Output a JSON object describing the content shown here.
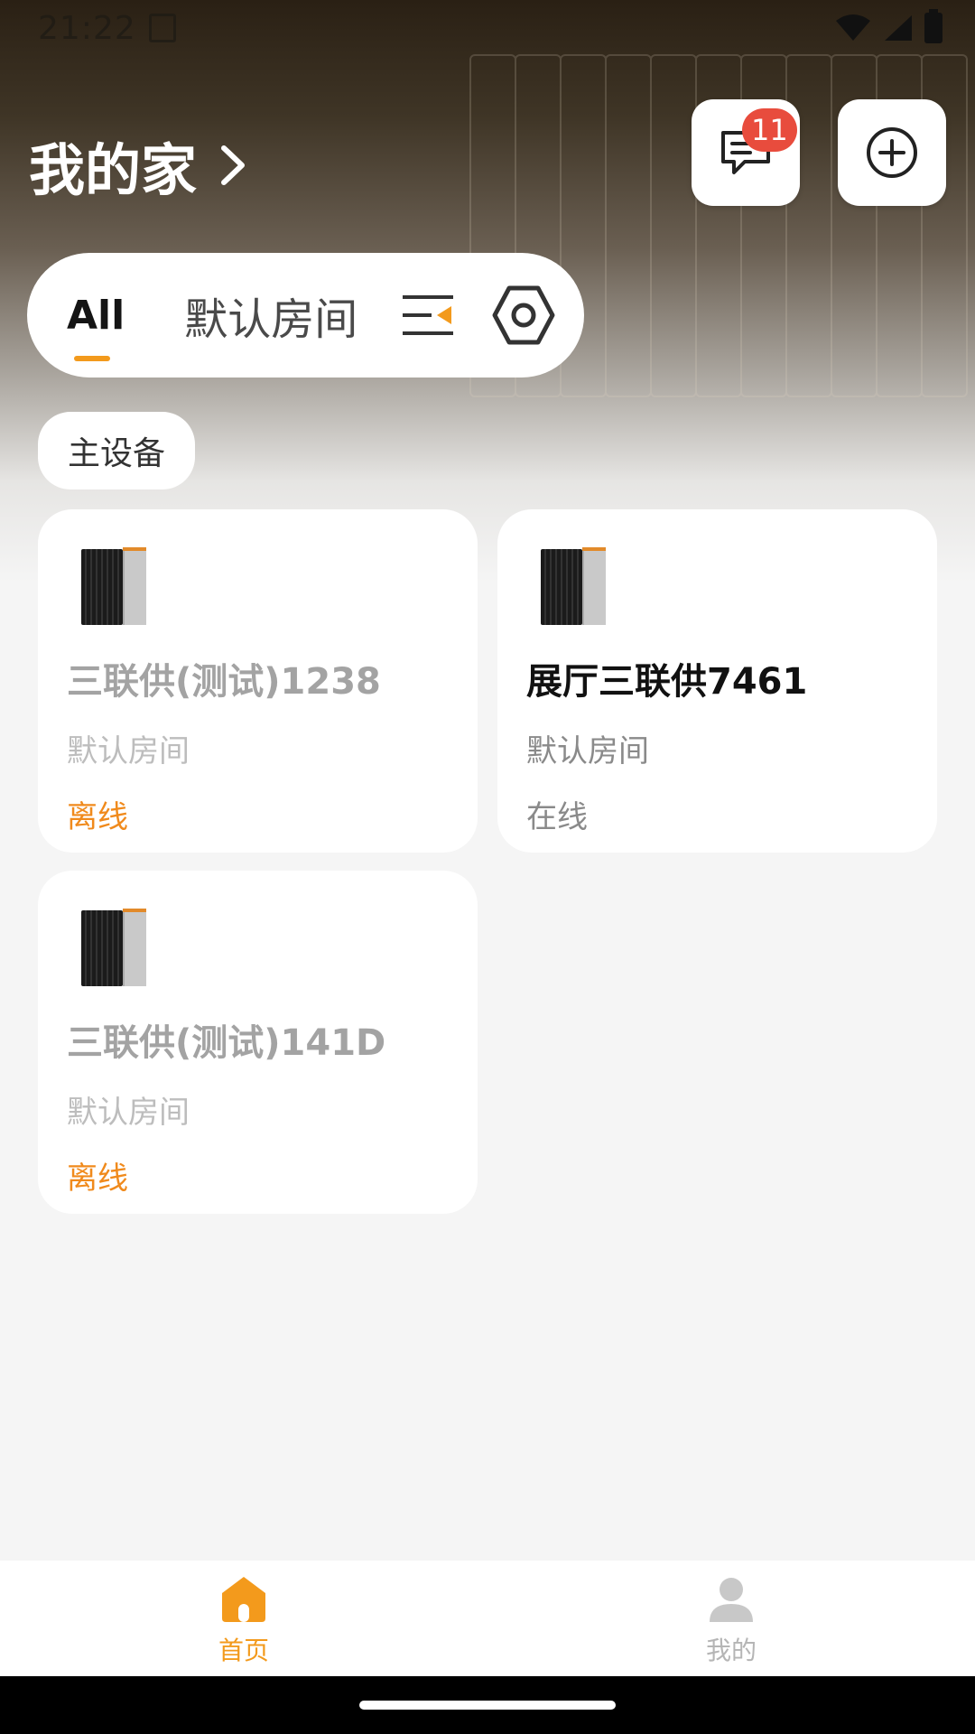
{
  "status_bar": {
    "time": "21:22"
  },
  "header": {
    "home_title": "我的家",
    "message_badge": "11"
  },
  "tabs": {
    "all": "All",
    "room": "默认房间"
  },
  "section": {
    "label": "主设备"
  },
  "devices": [
    {
      "name": "三联供(测试)1238",
      "room": "默认房间",
      "status": "离线"
    },
    {
      "name": "展厅三联供7461",
      "room": "默认房间",
      "status": "在线"
    },
    {
      "name": "三联供(测试)141D",
      "room": "默认房间",
      "status": "离线"
    }
  ],
  "bottom_nav": {
    "home": "首页",
    "mine": "我的"
  },
  "colors": {
    "accent": "#f39a1c",
    "badge": "#e84c3d",
    "offline": "#f08a1c"
  }
}
